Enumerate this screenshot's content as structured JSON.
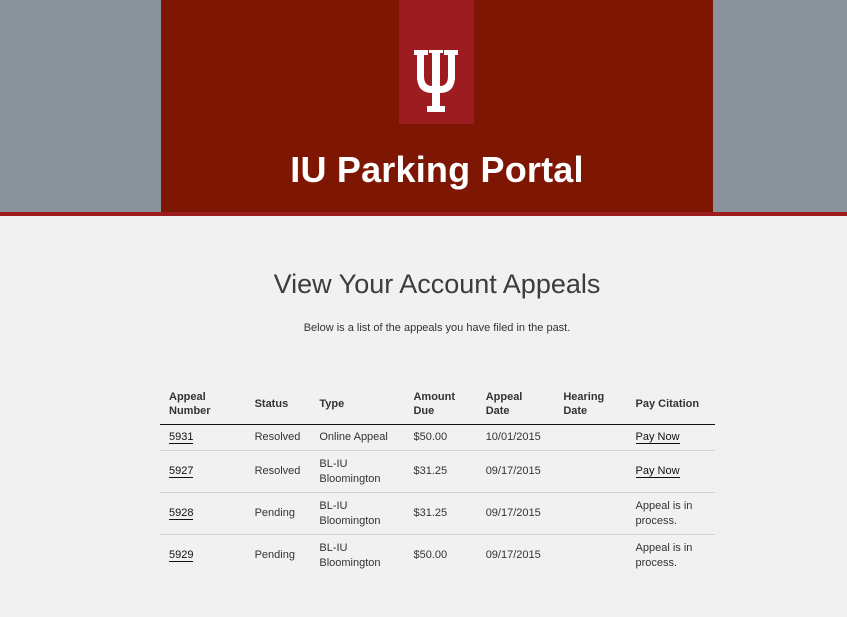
{
  "header": {
    "portal_title": "IU Parking Portal",
    "logo_name": "iu-trident-logo",
    "colors": {
      "crimson_dark": "#7d1704",
      "crimson": "#9d1c20",
      "gray_band": "#8a929c",
      "page_bg": "#f1f1f1"
    }
  },
  "main": {
    "title": "View Your Account Appeals",
    "subtitle": "Below is a list of the appeals you have filed in the past."
  },
  "table": {
    "columns": {
      "appeal_number": "Appeal Number",
      "status": "Status",
      "type": "Type",
      "amount_due": "Amount Due",
      "appeal_date": "Appeal Date",
      "hearing_date": "Hearing Date",
      "pay_citation": "Pay Citation"
    },
    "rows": [
      {
        "appeal_number": "5931",
        "status": "Resolved",
        "type": "Online Appeal",
        "amount_due": "$50.00",
        "appeal_date": "10/01/2015",
        "hearing_date": "",
        "pay_citation": "Pay Now"
      },
      {
        "appeal_number": "5927",
        "status": "Resolved",
        "type": "BL-IU Bloomington",
        "amount_due": "$31.25",
        "appeal_date": "09/17/2015",
        "hearing_date": "",
        "pay_citation": "Pay Now"
      },
      {
        "appeal_number": "5928",
        "status": "Pending",
        "type": "BL-IU Bloomington",
        "amount_due": "$31.25",
        "appeal_date": "09/17/2015",
        "hearing_date": "",
        "pay_citation": "Appeal is in process."
      },
      {
        "appeal_number": "5929",
        "status": "Pending",
        "type": "BL-IU Bloomington",
        "amount_due": "$50.00",
        "appeal_date": "09/17/2015",
        "hearing_date": "",
        "pay_citation": "Appeal is in process."
      }
    ]
  }
}
